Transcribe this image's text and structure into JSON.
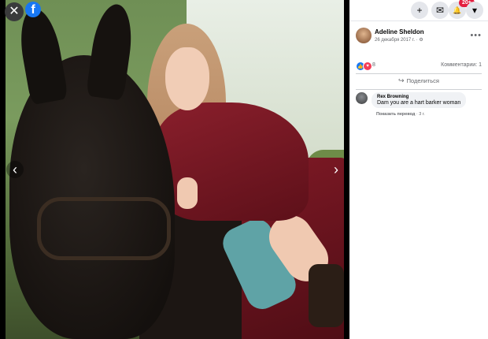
{
  "viewer": {
    "close_icon": "close-icon",
    "logo_letter": "f",
    "prev_icon": "chevron-left-icon",
    "next_icon": "chevron-right-icon",
    "prev_glyph": "‹",
    "next_glyph": "›",
    "close_glyph": "✕"
  },
  "topbar": {
    "add_glyph": "+",
    "messenger_glyph": "✉",
    "notifications_glyph": "🔔",
    "notifications_badge": "20+",
    "menu_glyph": "▾"
  },
  "post": {
    "author": "Adeline Sheldon",
    "date": "26 декабря 2017 г. · ",
    "privacy_glyph": "⚙",
    "more_glyph": "•••",
    "reaction_count": "8",
    "comments_label": "Комментарии: 1",
    "share_label": "Поделиться",
    "share_glyph": "↪"
  },
  "comments": [
    {
      "author": "Rex Browning",
      "text": "Dam you are a hart barker woman",
      "translate_label": "Показать перевод",
      "time": " · 3 г."
    }
  ],
  "colors": {
    "brand": "#1877f2",
    "badge": "#e41e3f",
    "panel_bg": "#ffffff",
    "viewer_bg": "#000000"
  }
}
